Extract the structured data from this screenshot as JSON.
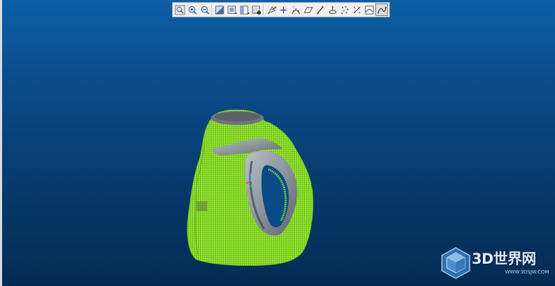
{
  "toolbar": {
    "tools": [
      {
        "id": "zoom-window",
        "icon": "zoom-window-icon"
      },
      {
        "id": "zoom-in",
        "icon": "zoom-in-icon"
      },
      {
        "id": "zoom-out",
        "icon": "zoom-out-icon"
      },
      {
        "id": "shaded-view",
        "icon": "shaded-view-icon"
      },
      {
        "id": "view-cube",
        "icon": "view-cube-icon"
      },
      {
        "id": "wireframe-view",
        "icon": "wireframe-view-icon"
      },
      {
        "id": "layer-manager",
        "icon": "layer-manager-icon"
      },
      {
        "id": "point-select",
        "icon": "point-select-icon"
      },
      {
        "id": "add-point",
        "icon": "add-point-icon"
      },
      {
        "id": "curve-points",
        "icon": "curve-points-icon"
      },
      {
        "id": "plane",
        "icon": "plane-icon"
      },
      {
        "id": "line-tool",
        "icon": "line-tool-icon"
      },
      {
        "id": "circle-tool",
        "icon": "circle-tool-icon"
      },
      {
        "id": "point-cloud",
        "icon": "point-cloud-icon"
      },
      {
        "id": "trim-points",
        "icon": "trim-points-icon"
      },
      {
        "id": "surface-edit",
        "icon": "surface-edit-icon"
      },
      {
        "id": "curve-connect",
        "icon": "curve-connect-icon",
        "active": true
      }
    ]
  },
  "scene": {
    "object": "detergent-bottle-point-cloud-overlay",
    "pointcloud_color": "#88e02a",
    "surface_color": "#9097a0"
  },
  "watermark": {
    "title": "3D世界网",
    "url": "WWW.3DSJW.COM"
  },
  "colors": {
    "background_top": "#0d5fa7",
    "background_bottom": "#052b53",
    "toolbar_bg": "#f0f0f0"
  }
}
